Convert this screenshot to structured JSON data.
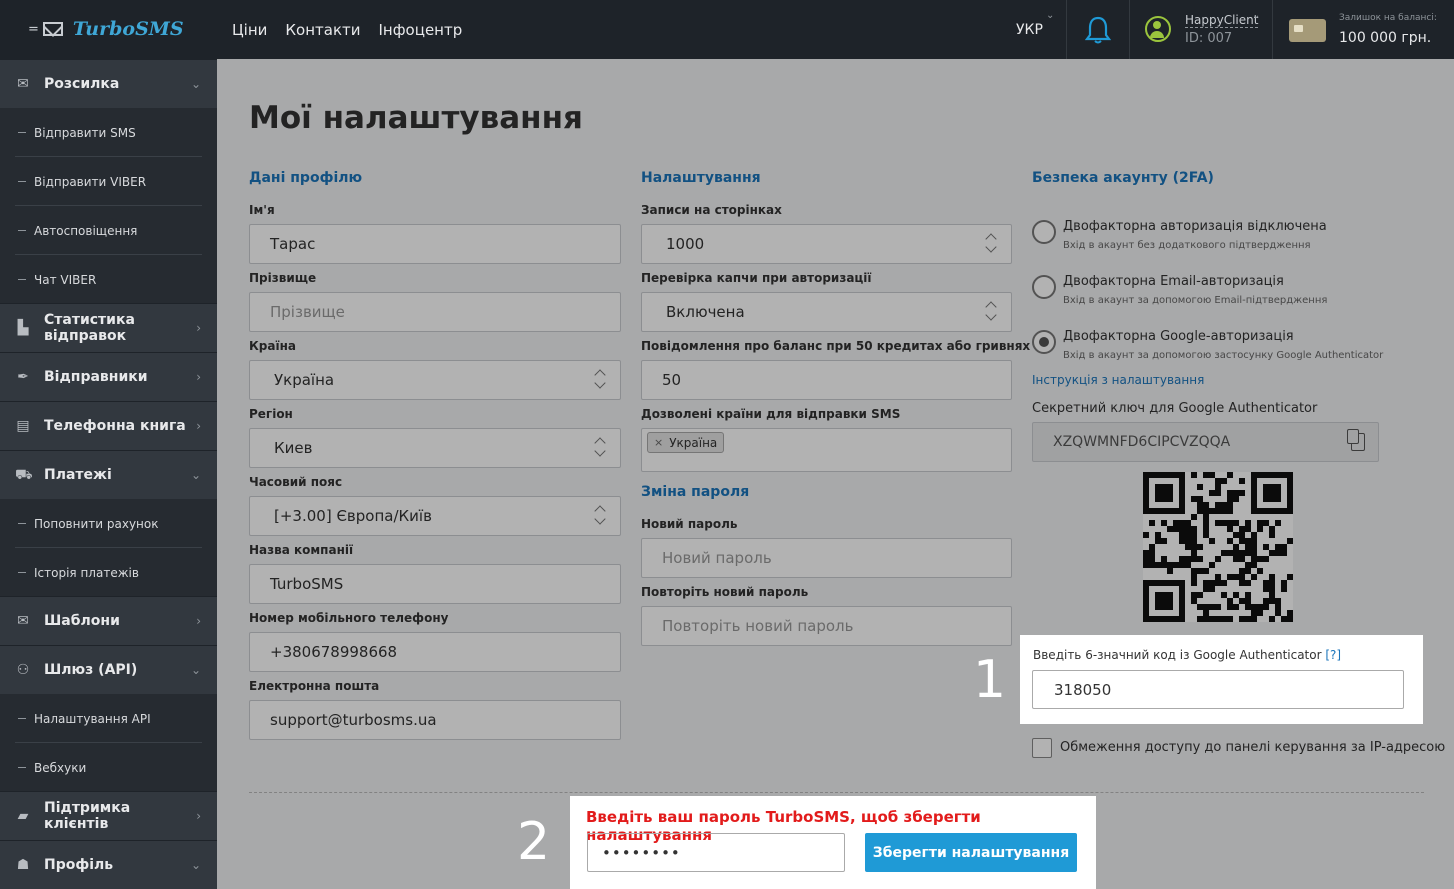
{
  "topbar": {
    "logo_text": "TurboSMS",
    "nav": [
      "Ціни",
      "Контакти",
      "Інфоцентр"
    ],
    "lang": "УКР",
    "user_name": "HappyClient",
    "user_id": "ID: 007",
    "balance_label": "Залишок на балансі:",
    "balance_value": "100 000 грн."
  },
  "sidebar": {
    "sections": [
      {
        "label": "Розсилка",
        "icon": "envelope-icon",
        "chev": "down"
      },
      {
        "label": "Статистика відправок",
        "icon": "chart-icon",
        "chev": "right"
      },
      {
        "label": "Відправники",
        "icon": "feather-icon",
        "chev": "right"
      },
      {
        "label": "Телефонна книга",
        "icon": "address-book-icon",
        "chev": "right"
      },
      {
        "label": "Платежі",
        "icon": "cart-icon",
        "chev": "down"
      },
      {
        "label": "Шаблони",
        "icon": "envelope-icon",
        "chev": "right"
      },
      {
        "label": "Шлюз (API)",
        "icon": "sitemap-icon",
        "chev": "down"
      },
      {
        "label": "Підтримка клієнтів",
        "icon": "chat-icon",
        "chev": "right"
      },
      {
        "label": "Профіль",
        "icon": "user-icon",
        "chev": "down"
      }
    ],
    "sub_rozsylka": [
      "Відправити SMS",
      "Відправити VIBER",
      "Автосповіщення",
      "Чат VIBER"
    ],
    "sub_platezhi": [
      "Поповнити рахунок",
      "Історія платежів"
    ],
    "sub_api": [
      "Налаштування API",
      "Вебхуки"
    ]
  },
  "main": {
    "title": "Мої налаштування",
    "profile": {
      "heading": "Дані профілю",
      "first_name_label": "Ім'я",
      "first_name_value": "Тарас",
      "last_name_label": "Прізвище",
      "last_name_placeholder": "Прізвище",
      "country_label": "Країна",
      "country_value": "Україна",
      "region_label": "Регіон",
      "region_value": "Киев",
      "timezone_label": "Часовий пояс",
      "timezone_value": "[+3.00] Європа/Київ",
      "company_label": "Назва компанії",
      "company_value": "TurboSMS",
      "phone_label": "Номер мобільного телефону",
      "phone_value": "+380678998668",
      "email_label": "Електронна пошта",
      "email_value": "support@turbosms.ua"
    },
    "settings": {
      "heading": "Налаштування",
      "records_label": "Записи на сторінках",
      "records_value": "1000",
      "captcha_label": "Перевірка капчи при авторизації",
      "captcha_value": "Включена",
      "balance_notify_label": "Повідомлення про баланс при 50 кредитах або гривнях",
      "balance_notify_value": "50",
      "allowed_countries_label": "Дозволені країни для відправки SMS",
      "allowed_countries_tag": "Україна",
      "password_heading": "Зміна пароля",
      "new_password_label": "Новий пароль",
      "new_password_placeholder": "Новий пароль",
      "repeat_password_label": "Повторіть новий пароль",
      "repeat_password_placeholder": "Повторіть новий пароль"
    },
    "security": {
      "heading": "Безпека акаунту (2FA)",
      "options": [
        {
          "title": "Двофакторна авторизація відключена",
          "sub": "Вхід в акаунт без додаткового підтвердження",
          "selected": false
        },
        {
          "title": "Двофакторна Email-авторизація",
          "sub": "Вхід в акаунт за допомогою Email-підтвердження",
          "selected": false
        },
        {
          "title": "Двофакторна Google-авторизація",
          "sub": "Вхід в акаунт за допомогою застосунку Google Authenticator",
          "selected": true
        }
      ],
      "instruction_link": "Інструкція з налаштування",
      "secret_label": "Секретний ключ для Google Authenticator",
      "secret_value": "XZQWMNFD6CIPCVZQQA",
      "code_label": "Введіть 6-значний код із Google Authenticator",
      "code_help": "[?]",
      "code_value": "318050",
      "ip_restrict_label": "Обмеження доступу до панелі керування за IP-адресою"
    },
    "save": {
      "warning": "Введіть ваш пароль TurboSMS, щоб зберегти налаштування",
      "password_value": "••••••••",
      "button": "Зберегти налаштування"
    },
    "step_numbers": [
      "1",
      "2"
    ]
  }
}
